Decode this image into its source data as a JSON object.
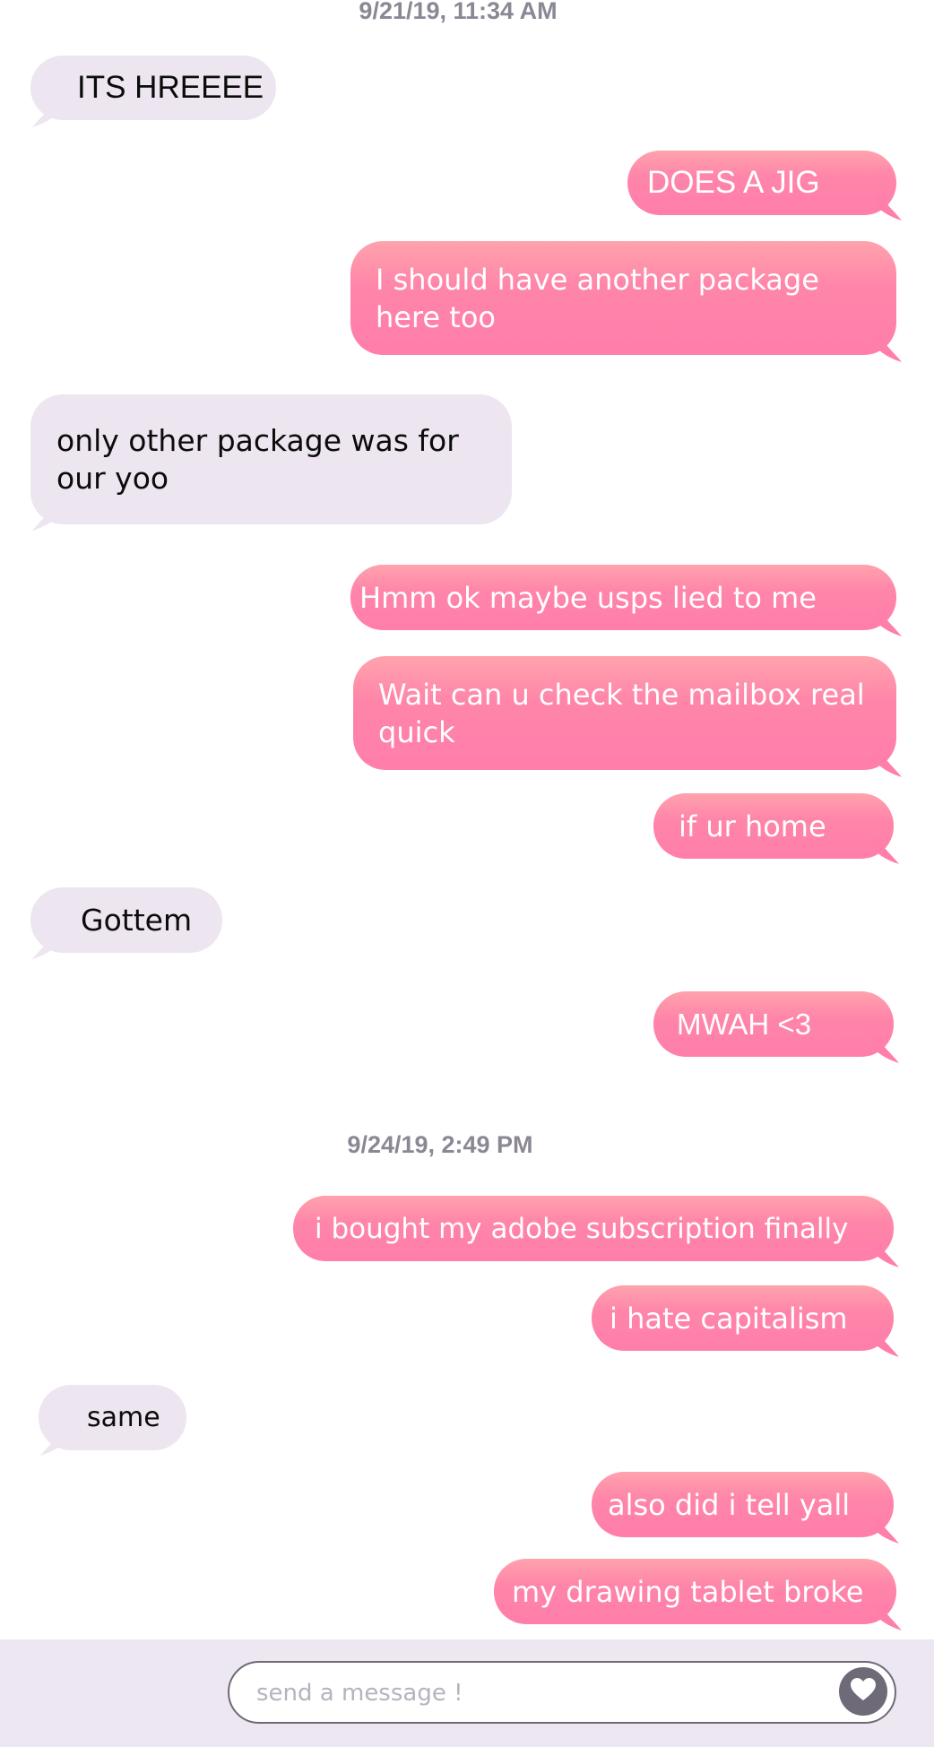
{
  "timestamps": [
    "9/21/19, 11:34 AM",
    "9/24/19, 2:49 PM"
  ],
  "messages": [
    {
      "from": "them",
      "text": "ITS HREEEE"
    },
    {
      "from": "me",
      "text": "DOES A JIG"
    },
    {
      "from": "me",
      "text": "I should have another package here too"
    },
    {
      "from": "them",
      "text": "only other package was for our yoo"
    },
    {
      "from": "me",
      "text": "Hmm ok maybe usps lied to me"
    },
    {
      "from": "me",
      "text": "Wait can u check the mailbox real quick"
    },
    {
      "from": "me",
      "text": "if ur home"
    },
    {
      "from": "them",
      "text": "Gottem"
    },
    {
      "from": "me",
      "text": "MWAH <3"
    },
    {
      "from": "me",
      "text": "i bought my adobe subscription finally"
    },
    {
      "from": "me",
      "text": "i hate capitalism"
    },
    {
      "from": "them",
      "text": "same"
    },
    {
      "from": "me",
      "text": "also did i tell yall"
    },
    {
      "from": "me",
      "text": "my drawing tablet broke"
    }
  ],
  "composer": {
    "placeholder": "send a message !",
    "send_icon": "heart-icon"
  },
  "colors": {
    "sent_bubble": "#ff80aa",
    "received_bubble": "#ede5f0",
    "composer_bar": "#ece7f1",
    "timestamp": "#8b8794"
  }
}
